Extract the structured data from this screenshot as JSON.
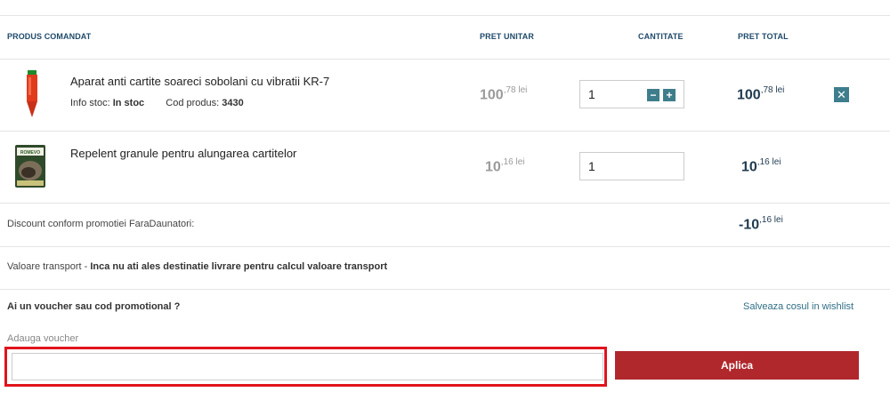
{
  "headers": {
    "product": "PRODUS COMANDAT",
    "unit_price": "PRET UNITAR",
    "quantity": "CANTITATE",
    "total_price": "PRET TOTAL"
  },
  "items": [
    {
      "name": "Aparat anti cartite soareci sobolani cu vibratii KR-7",
      "stock_label": "Info stoc:",
      "stock_value": "In stoc",
      "code_label": "Cod produs:",
      "code_value": "3430",
      "unit_int": "100",
      "unit_dec": ",78 lei",
      "quantity": "1",
      "total_int": "100",
      "total_dec": ",78 lei",
      "image_icon": "red-stake-device-image"
    },
    {
      "name": "Repelent granule pentru alungarea cartitelor",
      "unit_int": "10",
      "unit_dec": ",16 lei",
      "quantity": "1",
      "total_int": "10",
      "total_dec": ",16 lei",
      "image_icon": "granule-pack-image",
      "brand": "ROMEVO"
    }
  ],
  "discount": {
    "label": "Discount conform promotiei FaraDaunatori:",
    "int": "-10",
    "dec": ",16 lei"
  },
  "transport": {
    "label": "Valoare transport",
    "sep": " - ",
    "note": "Inca nu ati ales destinatie livrare pentru calcul valoare transport"
  },
  "voucher": {
    "question": "Ai un voucher sau cod promotional ?",
    "wishlist_link": "Salveaza cosul in wishlist",
    "field_label": "Adauga voucher",
    "value": "",
    "apply_label": "Aplica"
  },
  "colors": {
    "accent": "#3e7e8c",
    "apply": "#b0272c",
    "highlight": "#e0141c",
    "header_text": "#1f4a6b"
  }
}
